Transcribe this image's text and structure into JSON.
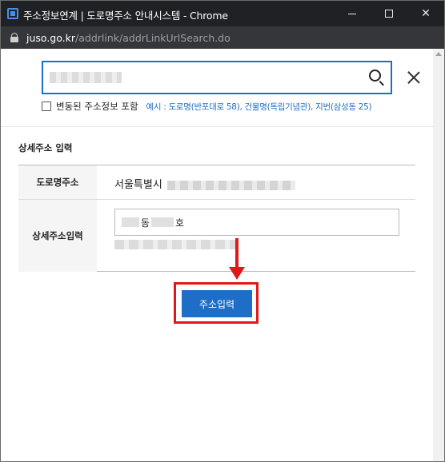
{
  "window": {
    "title": "주소정보연계 | 도로명주소 안내시스템 - Chrome",
    "url_domain": "juso.go.kr",
    "url_path": "/addrlink/addrLinkUrlSearch.do"
  },
  "search": {
    "value": "",
    "checkbox_label": "변동된 주소정보 포함",
    "example": "예시 : 도로명(반포대로 58), 건물명(독립기념관), 지번(삼성동 25)"
  },
  "detail": {
    "section_title": "상세주소 입력",
    "road_label": "도로명주소",
    "road_value": "서울특별시",
    "detail_label": "상세주소입력",
    "detail_dong": "동",
    "detail_ho": "호"
  },
  "actions": {
    "submit_label": "주소입력"
  },
  "colors": {
    "accent": "#1e6ec8",
    "highlight": "#e01818",
    "titlebar": "#202124"
  }
}
